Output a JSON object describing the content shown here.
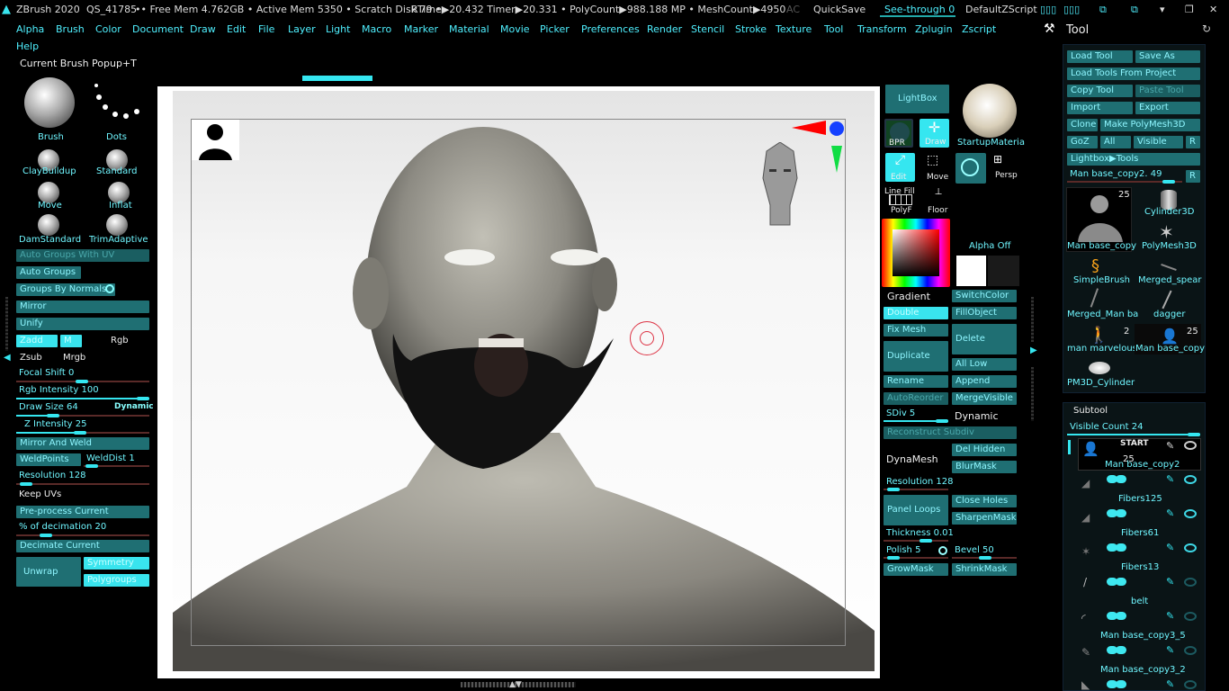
{
  "topbar": {
    "app": "ZBrush 2020",
    "file": "QS_41785",
    "stats": "•• Free Mem 4.762GB • Active Mem 5350 • Scratch Disk 79 •",
    "rtime": "RTime▶20.432 Timer▶20.331 • PolyCount▶988.188 MP • MeshCount▶4950",
    "ac": "AC",
    "quicksave": "QuickSave",
    "seethrough": "See-through  0",
    "script": "DefaultZScript"
  },
  "menu": [
    "Alpha",
    "Brush",
    "Color",
    "Document",
    "Draw",
    "Edit",
    "File",
    "Layer",
    "Light",
    "Macro",
    "Marker",
    "Material",
    "Movie",
    "Picker",
    "Preferences",
    "Render",
    "Stencil",
    "Stroke",
    "Texture",
    "Tool",
    "Transform",
    "Zplugin",
    "Zscript",
    "Help"
  ],
  "current_brush": "Current Brush Popup+T",
  "brushes": {
    "brush": "Brush",
    "dots": "Dots",
    "claybuildup": "ClayBuildup",
    "standard": "Standard",
    "move": "Move",
    "inflat": "Inflat",
    "damstandard": "DamStandard",
    "trimadaptive": "TrimAdaptive"
  },
  "left": {
    "auto_groups_uv": "Auto Groups With UV",
    "auto_groups": "Auto Groups",
    "groups_by_normals": "Groups By Normals",
    "mirror": "Mirror",
    "unify": "Unify",
    "zadd": "Zadd",
    "m": "M",
    "rgb": "Rgb",
    "zsub": "Zsub",
    "mrgb": "Mrgb",
    "focal_shift": "Focal Shift 0",
    "rgb_intensity": "Rgb Intensity 100",
    "draw_size": "Draw Size 64",
    "dynamic": "Dynamic",
    "z_intensity": "Z Intensity 25",
    "mirror_weld": "Mirror And Weld",
    "weldpoints": "WeldPoints",
    "welddist": "WeldDist 1",
    "resolution": "Resolution 128",
    "keep_uvs": "Keep UVs",
    "preprocess": "Pre-process Current",
    "decimation": "% of decimation 20",
    "decimate": "Decimate Current",
    "unwrap": "Unwrap",
    "symmetry": "Symmetry",
    "polygroups": "Polygroups"
  },
  "mid": {
    "lightbox": "LightBox",
    "startup_material": "StartupMateria",
    "bpr": "BPR",
    "draw": "Draw",
    "edit": "Edit",
    "move": "Move",
    "persp": "Persp",
    "polyf": "PolyF",
    "floor": "Floor",
    "linefill": "Line Fill",
    "dynamic_label": "Dynamic",
    "alpha_off": "Alpha Off",
    "gradient": "Gradient",
    "switchcolor": "SwitchColor",
    "double": "Double",
    "fillobject": "FillObject",
    "fix_mesh": "Fix Mesh",
    "delete": "Delete",
    "duplicate": "Duplicate",
    "all_low": "All Low",
    "rename": "Rename",
    "append": "Append",
    "autoreorder": "AutoReorder",
    "mergevisible": "MergeVisible",
    "sdiv": "SDiv 5",
    "dynamic": "Dynamic",
    "reconstruct": "Reconstruct Subdiv",
    "dynamesh": "DynaMesh",
    "del_hidden": "Del Hidden",
    "blurmask": "BlurMask",
    "resolution": "Resolution 128",
    "panel_loops": "Panel Loops",
    "close_holes": "Close Holes",
    "sharpenmask": "SharpenMask",
    "thickness": "Thickness 0.01",
    "polish": "Polish 5",
    "bevel": "Bevel 50",
    "growmask": "GrowMask",
    "shrinkmask": "ShrinkMask"
  },
  "tool": {
    "title": "Tool",
    "load_tool": "Load Tool",
    "save_as": "Save As",
    "load_from_project": "Load Tools From Project",
    "copy_tool": "Copy Tool",
    "paste_tool": "Paste Tool",
    "import": "Import",
    "export": "Export",
    "clone": "Clone",
    "make_polymesh": "Make PolyMesh3D",
    "goz": "GoZ",
    "all": "All",
    "visible": "Visible",
    "r": "R",
    "lightbox_tools": "Lightbox▶Tools",
    "current_tool": "Man base_copy2. 49",
    "items": [
      "Man base_copy",
      "Cylinder3D",
      "PolyMesh3D",
      "SimpleBrush",
      "Merged_spear",
      "Merged_Man ba",
      "dagger",
      "man marvelous",
      "Man base_copy",
      "PM3D_Cylinder"
    ],
    "counts": {
      "man_base": "25",
      "marvelous": "2",
      "man_base2": "25"
    }
  },
  "subtool": {
    "title": "Subtool",
    "visible_count": "Visible Count 24",
    "start": "START",
    "first_count": "25",
    "items": [
      "Man base_copy2",
      "Fibers125",
      "Fibers61",
      "Fibers13",
      "belt",
      "Man base_copy3_5",
      "Man base_copy3_2"
    ]
  },
  "colors": {
    "accent": "#35e6f0",
    "button": "#1f6f73",
    "text_cyan": "#6ff6ff"
  }
}
